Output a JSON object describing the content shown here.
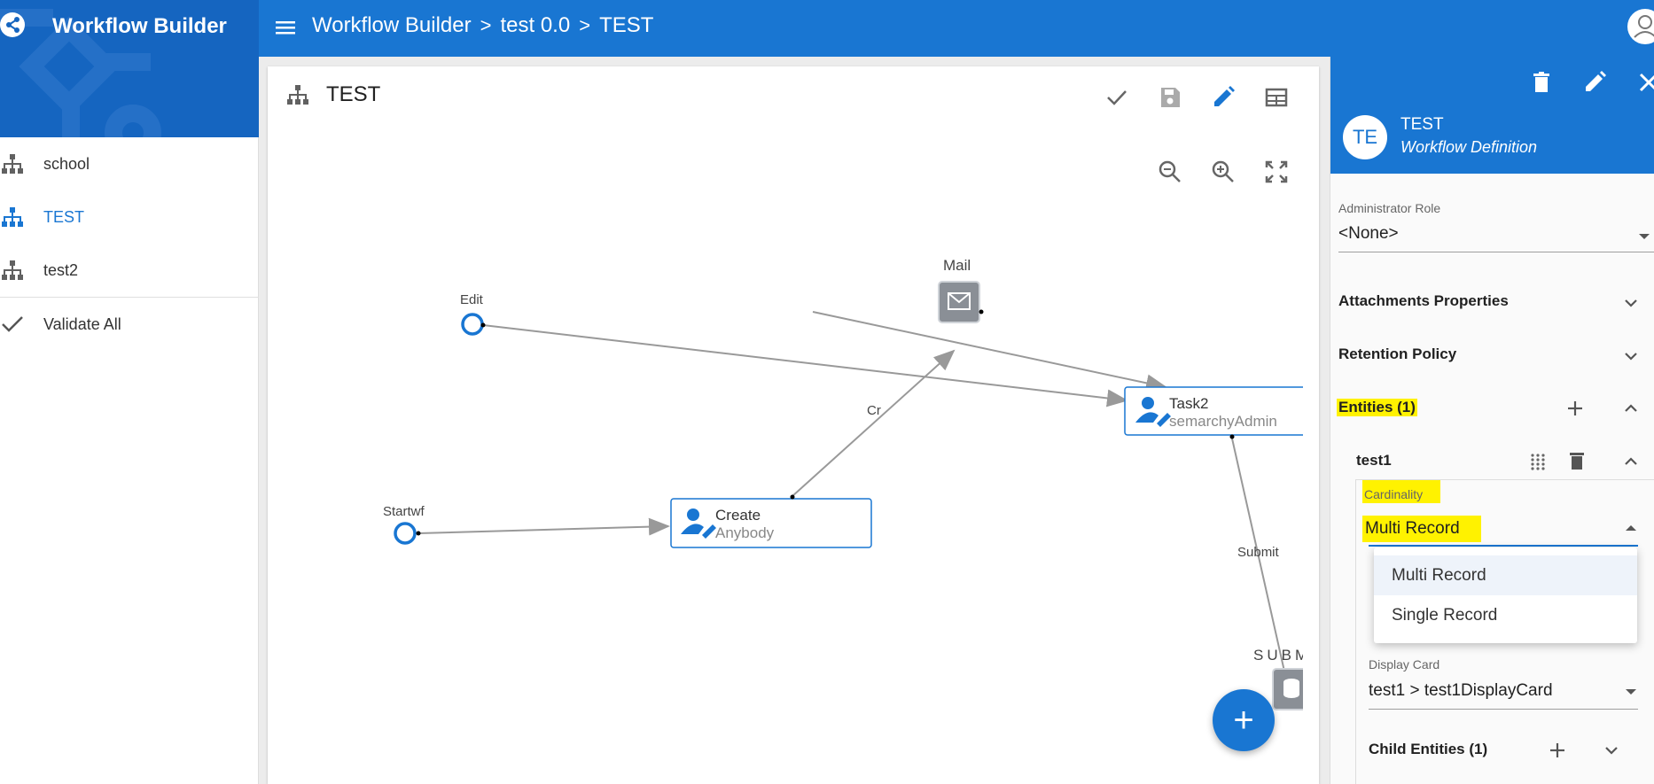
{
  "app": {
    "title": "Workflow Builder",
    "accent_color": "#1976d2",
    "highlight_color": "#fff200"
  },
  "breadcrumbs": [
    "Workflow Builder",
    "test 0.0",
    "TEST"
  ],
  "breadcrumb_separator": ">",
  "sidebar": {
    "items": [
      {
        "label": "school",
        "icon": "hierarchy-icon",
        "active": false
      },
      {
        "label": "TEST",
        "icon": "hierarchy-icon",
        "active": true
      },
      {
        "label": "test2",
        "icon": "hierarchy-icon",
        "active": false
      }
    ],
    "validate_label": "Validate All"
  },
  "canvas": {
    "title": "TEST",
    "toolbar": [
      "check-icon",
      "save-icon",
      "edit-icon",
      "table-icon"
    ],
    "zoom_tools": [
      "zoom-out-icon",
      "zoom-in-icon",
      "fit-screen-icon"
    ],
    "nodes": {
      "edit": "Edit",
      "startwf": "Startwf",
      "mail": "Mail",
      "create_title": "Create",
      "create_sub": "Anybody",
      "task2_title": "Task2",
      "task2_sub": "semarchyAdmin",
      "submit_node": "SUBM"
    },
    "edge_labels": {
      "cr": "Cr",
      "submit": "Submit"
    },
    "fab_label": "+"
  },
  "panel": {
    "avatar": "TE",
    "title": "TEST",
    "subtitle": "Workflow Definition",
    "admin_role_label": "Administrator Role",
    "admin_role_value": "<None>",
    "sections": {
      "attachments": "Attachments Properties",
      "retention": "Retention Policy",
      "entities": "Entities (1)"
    },
    "entity": {
      "name": "test1",
      "cardinality_label": "Cardinality",
      "cardinality_value": "Multi Record",
      "cardinality_options": [
        "Multi Record",
        "Single Record"
      ],
      "display_card_label": "Display Card",
      "display_card_value": "test1 > test1DisplayCard",
      "child_entities": "Child Entities (1)"
    }
  }
}
